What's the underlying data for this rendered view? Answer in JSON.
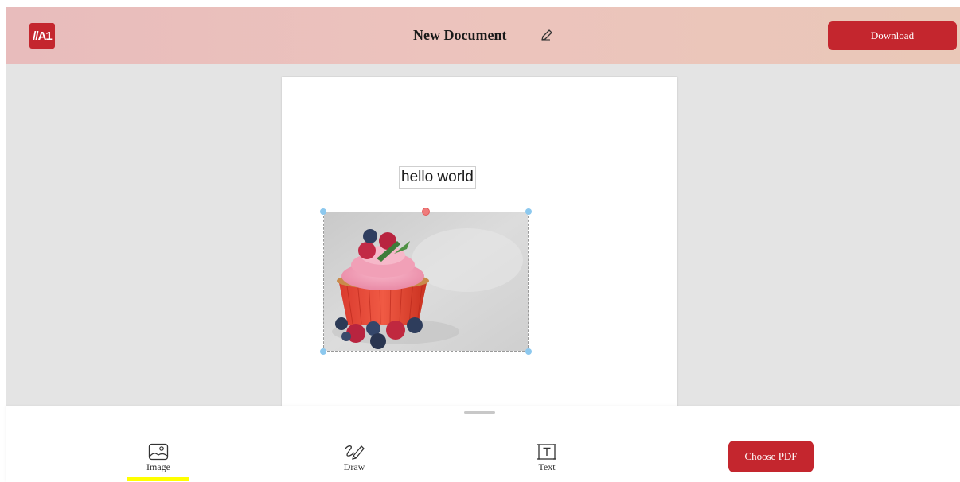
{
  "header": {
    "logo_text": "//A1",
    "document_title": "New Document",
    "download_label": "Download"
  },
  "canvas": {
    "text_element": "hello world",
    "image_element": {
      "subject": "cupcake with pink frosting, raspberries, blueberries and mint"
    }
  },
  "toolbar": {
    "tools": [
      {
        "label": "Image",
        "icon": "image-icon",
        "active": true
      },
      {
        "label": "Draw",
        "icon": "draw-icon",
        "active": false
      },
      {
        "label": "Text",
        "icon": "text-icon",
        "active": false
      }
    ],
    "choose_pdf_label": "Choose PDF"
  },
  "colors": {
    "brand_red": "#c4262e",
    "header_gradient_start": "#e8bcbc",
    "header_gradient_end": "#eac8b8",
    "workspace_bg": "#e4e4e4",
    "active_underline": "#ffff00",
    "selection_handle": "#8cc8ee",
    "rotate_handle": "#ef7b7b"
  }
}
